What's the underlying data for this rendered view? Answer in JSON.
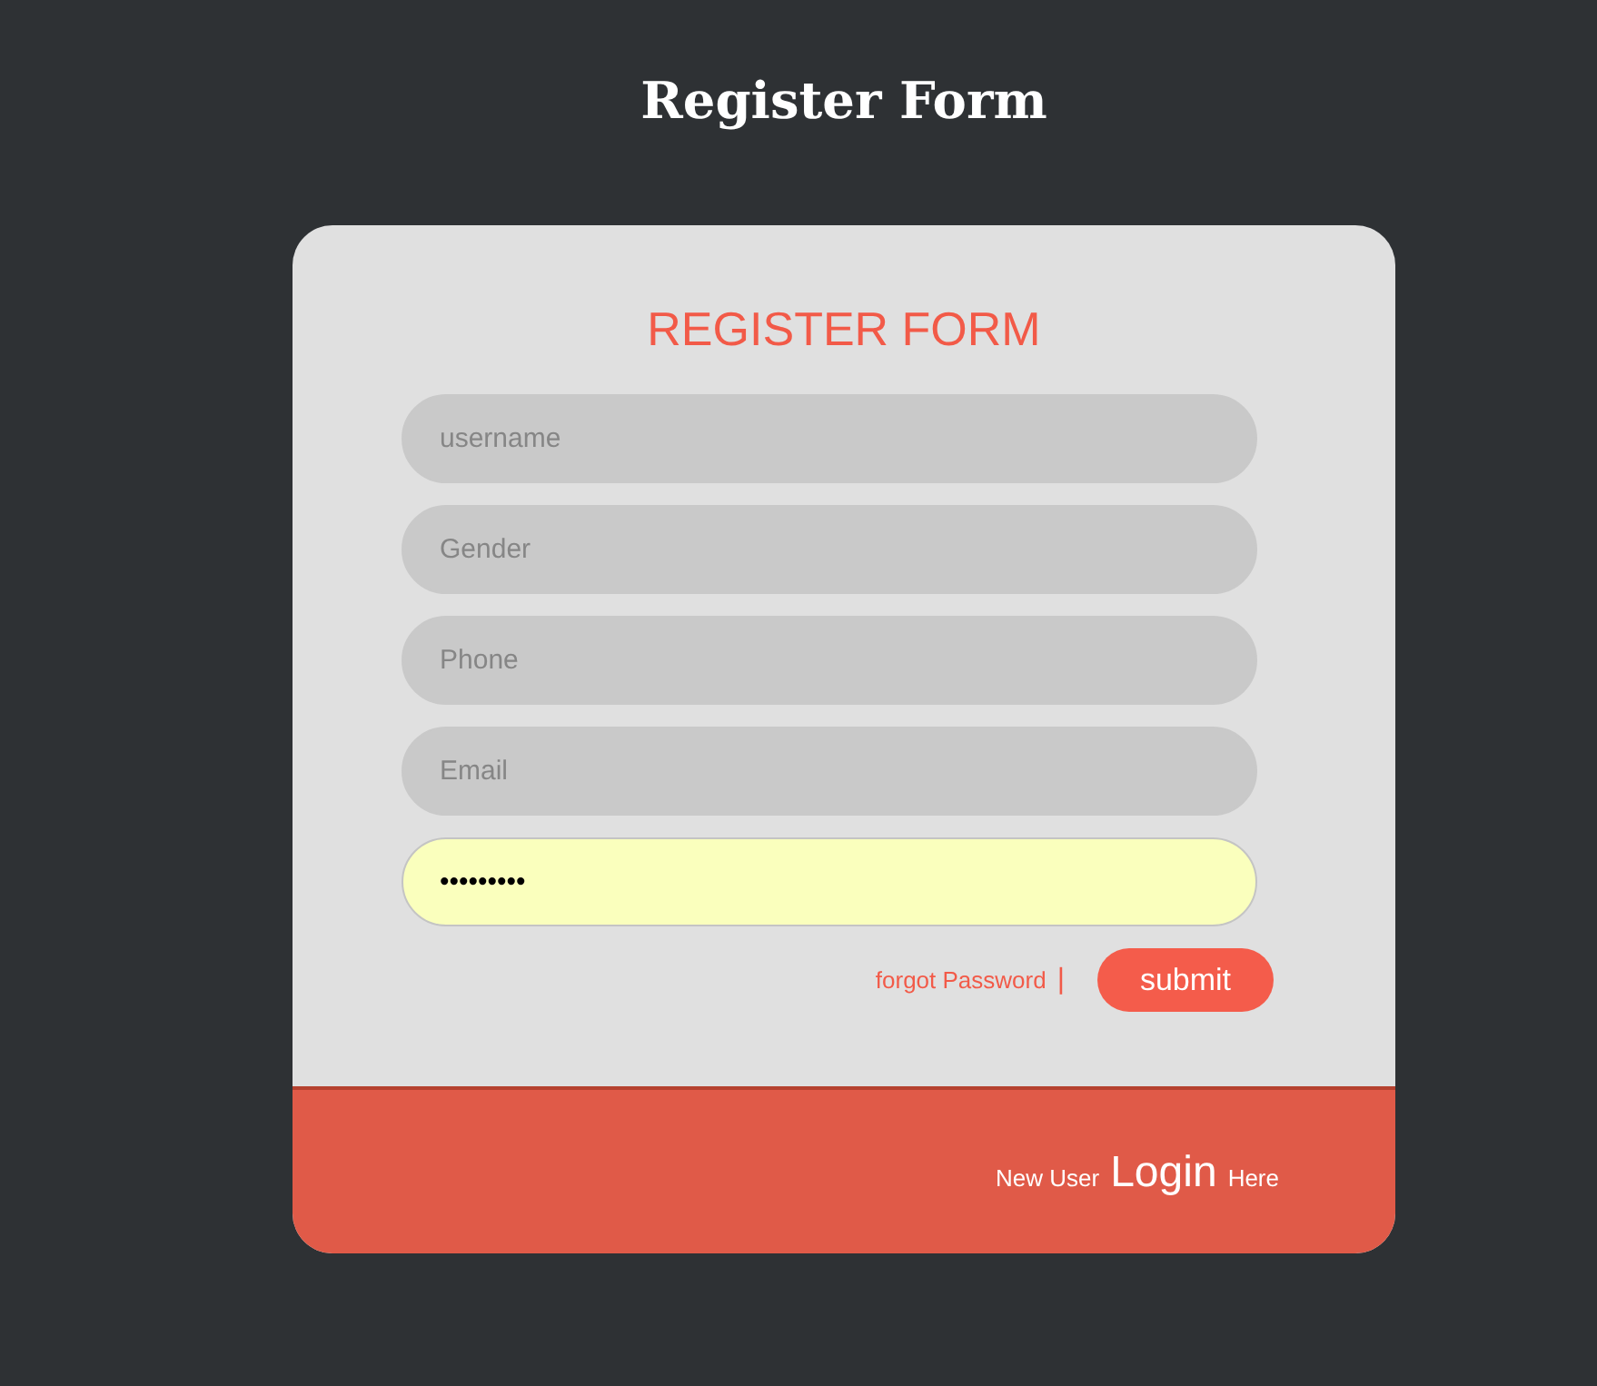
{
  "page_title": "Register Form",
  "form": {
    "heading": "REGISTER FORM",
    "fields": [
      {
        "placeholder": "username",
        "autofilled": false
      },
      {
        "placeholder": "Gender",
        "autofilled": false
      },
      {
        "placeholder": "Phone",
        "autofilled": false
      },
      {
        "placeholder": "Email",
        "autofilled": false
      },
      {
        "value": "•••••••••",
        "autofilled": true
      }
    ],
    "forgot_link": "forgot Password",
    "separator": "|",
    "submit_button": "submit"
  },
  "footer": {
    "prefix": "New User",
    "link": "Login",
    "suffix": "Here"
  }
}
